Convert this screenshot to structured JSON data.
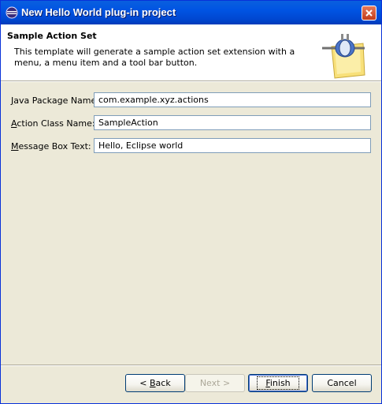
{
  "window": {
    "title": "New Hello World plug-in project",
    "app_icon": "eclipse-icon",
    "close_icon": "close-icon"
  },
  "banner": {
    "title": "Sample Action Set",
    "description": "This template will generate a sample action set extension with a menu, a menu item and a tool bar button.",
    "icon": "plugin-icon"
  },
  "form": {
    "package": {
      "label_mnemonic": "J",
      "label_rest": "ava Package Name:",
      "value": "com.example.xyz.actions"
    },
    "class": {
      "label_mnemonic": "A",
      "label_rest": "ction Class Name:",
      "value": "SampleAction"
    },
    "message": {
      "label_mnemonic": "M",
      "label_rest": "essage Box Text:",
      "value": "Hello, Eclipse world"
    }
  },
  "buttons": {
    "back_prefix": "< ",
    "back_mnemonic": "B",
    "back_rest": "ack",
    "next": "Next >",
    "finish_mnemonic": "F",
    "finish_rest": "inish",
    "cancel": "Cancel"
  },
  "colors": {
    "titlebar": "#0054e3",
    "dialog_bg": "#ece9d8",
    "close_button": "#c23c1b"
  }
}
